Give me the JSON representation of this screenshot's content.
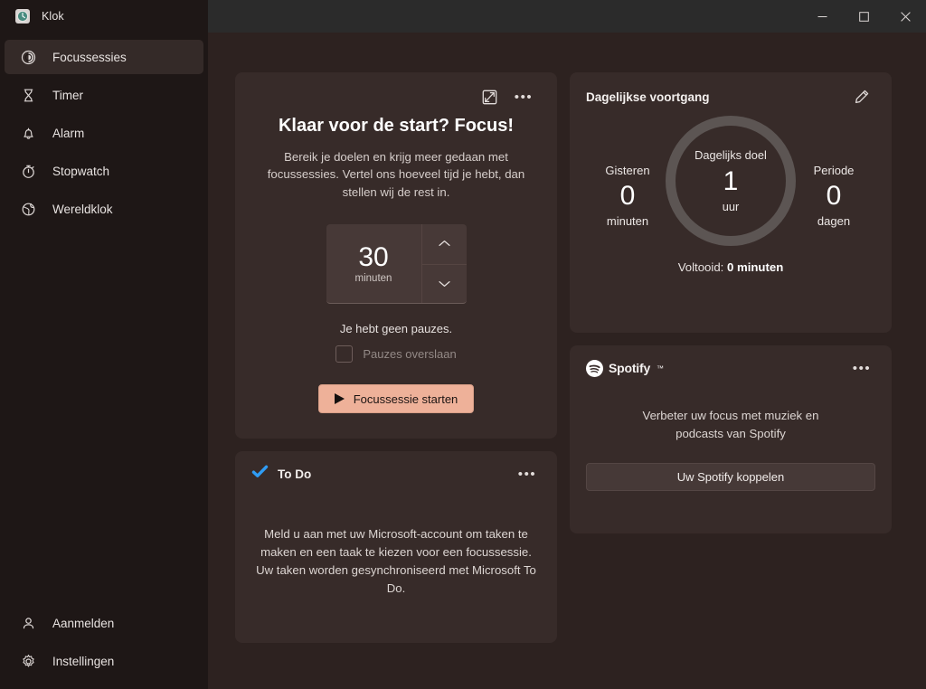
{
  "window": {
    "app_title": "Klok",
    "app_icon": "clock-icon",
    "controls": {
      "minimize": "minimize-icon",
      "maximize": "maximize-icon",
      "close": "close-icon"
    }
  },
  "sidebar": {
    "items": [
      {
        "label": "Focussessies",
        "icon": "focus-sessions-icon",
        "active": true
      },
      {
        "label": "Timer",
        "icon": "hourglass-icon",
        "active": false
      },
      {
        "label": "Alarm",
        "icon": "bell-icon",
        "active": false
      },
      {
        "label": "Stopwatch",
        "icon": "stopwatch-icon",
        "active": false
      },
      {
        "label": "Wereldklok",
        "icon": "globe-icon",
        "active": false
      }
    ],
    "bottom_items": [
      {
        "label": "Aanmelden",
        "icon": "person-icon"
      },
      {
        "label": "Instellingen",
        "icon": "gear-icon"
      }
    ]
  },
  "focus_card": {
    "popout_icon": "open-in-new-window-icon",
    "more_icon": "more-options-icon",
    "more_label": "•••",
    "heading": "Klaar voor de start? Focus!",
    "description": "Bereik je doelen en krijg meer gedaan met focussessies. Vertel ons hoeveel tijd je hebt, dan stellen wij de rest in.",
    "spinner": {
      "value": "30",
      "unit": "minuten",
      "up_icon": "chevron-up-icon",
      "down_icon": "chevron-down-icon"
    },
    "breaks_text": "Je hebt geen pauzes.",
    "skip_breaks_label": "Pauzes overslaan",
    "skip_breaks_checked": false,
    "start_button": "Focussessie starten",
    "start_icon": "play-icon",
    "accent_color": "#eeb199"
  },
  "todo_card": {
    "icon": "todo-check-icon",
    "title": "To Do",
    "more_label": "•••",
    "body": "Meld u aan met uw Microsoft-account om taken te maken en een taak te kiezen voor een focussessie. Uw taken worden gesynchroniseerd met Microsoft To Do.",
    "icon_color": "#2f9cf4"
  },
  "progress_card": {
    "title": "Dagelijkse voortgang",
    "edit_icon": "pencil-edit-icon",
    "left_stat": {
      "label": "Gisteren",
      "value": "0",
      "unit": "minuten"
    },
    "ring": {
      "label": "Dagelijks doel",
      "value": "1",
      "unit": "uur",
      "ring_color": "#5c5553",
      "progress_pct": 0
    },
    "right_stat": {
      "label": "Periode",
      "value": "0",
      "unit": "dagen"
    },
    "footer_prefix": "Voltooid: ",
    "footer_value": "0 minuten"
  },
  "spotify_card": {
    "logo_icon": "spotify-icon",
    "brand": "Spotify",
    "trademark": "™",
    "more_label": "•••",
    "body": "Verbeter uw focus met muziek en podcasts van Spotify",
    "button": "Uw Spotify koppelen"
  }
}
